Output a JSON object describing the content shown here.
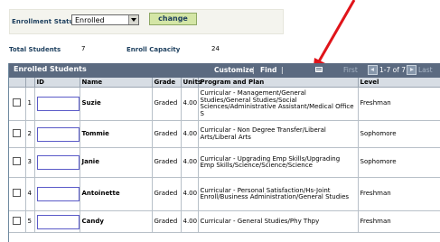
{
  "filter": {
    "status_label": "Enrollment Status",
    "status_value": "Enrolled",
    "change_label": "change"
  },
  "summary": {
    "total_label": "Total Students",
    "total_value": "7",
    "capacity_label": "Enroll Capacity",
    "capacity_value": "24"
  },
  "grid": {
    "title": "Enrolled Students",
    "customize": "Customize",
    "separator": "|",
    "find": "Find",
    "first": "First",
    "range": "1-7 of 7",
    "last": "Last",
    "columns": [
      "ID",
      "Name",
      "Grade",
      "Units",
      "Program and Plan",
      "Level"
    ],
    "rows": [
      {
        "num": "1",
        "name": "Suzie",
        "grade": "Graded",
        "units": "4.00",
        "program": "Curricular - Management/General Studies/General Studies/Social Sciences/Administrative Assistant/Medical Office S",
        "level": "Freshman"
      },
      {
        "num": "2",
        "name": "Tommie",
        "grade": "Graded",
        "units": "4.00",
        "program": "Curricular - Non Degree Transfer/Liberal Arts/Liberal Arts",
        "level": "Sophomore"
      },
      {
        "num": "3",
        "name": "Janie",
        "grade": "Graded",
        "units": "4.00",
        "program": "Curricular - Upgrading Emp Skills/Upgrading Emp Skills/Science/Science/Science",
        "level": "Sophomore"
      },
      {
        "num": "4",
        "name": "Antoinette",
        "grade": "Graded",
        "units": "4.00",
        "program": "Curricular - Personal Satisfaction/Hs-Joint Enroll/Business Administration/General Studies",
        "level": "Freshman"
      },
      {
        "num": "5",
        "name": "Candy",
        "grade": "Graded",
        "units": "4.00",
        "program": "Curricular - General Studies/Phy Thpy",
        "level": "Freshman"
      }
    ]
  },
  "colors": {
    "header_bar": "#5b6a80",
    "column_header": "#d7dde4",
    "label_blue": "#1d3f5e",
    "button_green": "#d4e6a6",
    "annotation_arrow": "#e0141a"
  },
  "icons": [
    "dropdown-arrow-icon",
    "download-icon",
    "previous-page-icon",
    "next-page-icon",
    "annotation-arrow"
  ]
}
